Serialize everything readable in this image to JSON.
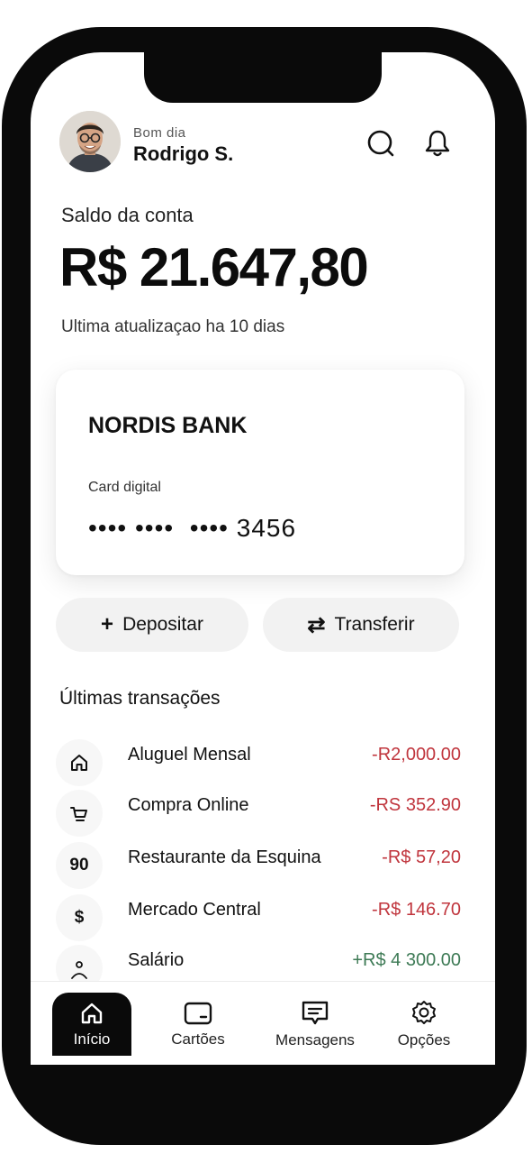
{
  "header": {
    "greeting": "Bom dia",
    "user_name": "Rodrigo S.",
    "avatar_icon": "person-avatar",
    "search_icon": "search-icon",
    "notification_icon": "bell-icon"
  },
  "balance": {
    "label": "Saldo da conta",
    "value": "R$ 21.647,80",
    "last_update": "Ultima atualizaçao ha 10 dias"
  },
  "card": {
    "bank_name": "NORDIS BANK",
    "type_label": "Card digital",
    "number_masked": "•••• ••••  •••• 3456"
  },
  "actions": {
    "deposit_glyph": "+",
    "deposit_label": "Depositar",
    "transfer_glyph": "⇄",
    "transfer_label": "Transferir"
  },
  "transactions": {
    "title": "Últimas transações",
    "items": [
      {
        "icon": "home-icon",
        "icon_text": "",
        "name": "Aluguel Mensal",
        "amount": "-R2,000.00",
        "kind": "debit"
      },
      {
        "icon": "cart-icon",
        "icon_text": "",
        "name": "Compra Online",
        "amount": "-RS 352.90",
        "kind": "debit"
      },
      {
        "icon": "restaurant-icon",
        "icon_text": "90",
        "name": "Restaurante da Esquina",
        "amount": "-R$ 57,20",
        "kind": "debit"
      },
      {
        "icon": "dollar-icon",
        "icon_text": "$",
        "name": "Mercado Central",
        "amount": "-R$ 146.70",
        "kind": "debit"
      },
      {
        "icon": "person-icon",
        "icon_text": "",
        "name": "Salário",
        "amount": "+R$ 4 300.00",
        "kind": "credit"
      }
    ]
  },
  "nav": {
    "items": [
      {
        "label": "Início",
        "icon": "home-icon",
        "active": true
      },
      {
        "label": "Cartões",
        "icon": "card-icon",
        "active": false
      },
      {
        "label": "Mensagens",
        "icon": "message-icon",
        "active": false
      },
      {
        "label": "Opções",
        "icon": "settings-gear-icon",
        "active": false
      }
    ]
  },
  "colors": {
    "debit": "#c0353d",
    "credit": "#3d7a55",
    "frame": "#0a0a0a",
    "button_bg": "#f2f2f2"
  }
}
